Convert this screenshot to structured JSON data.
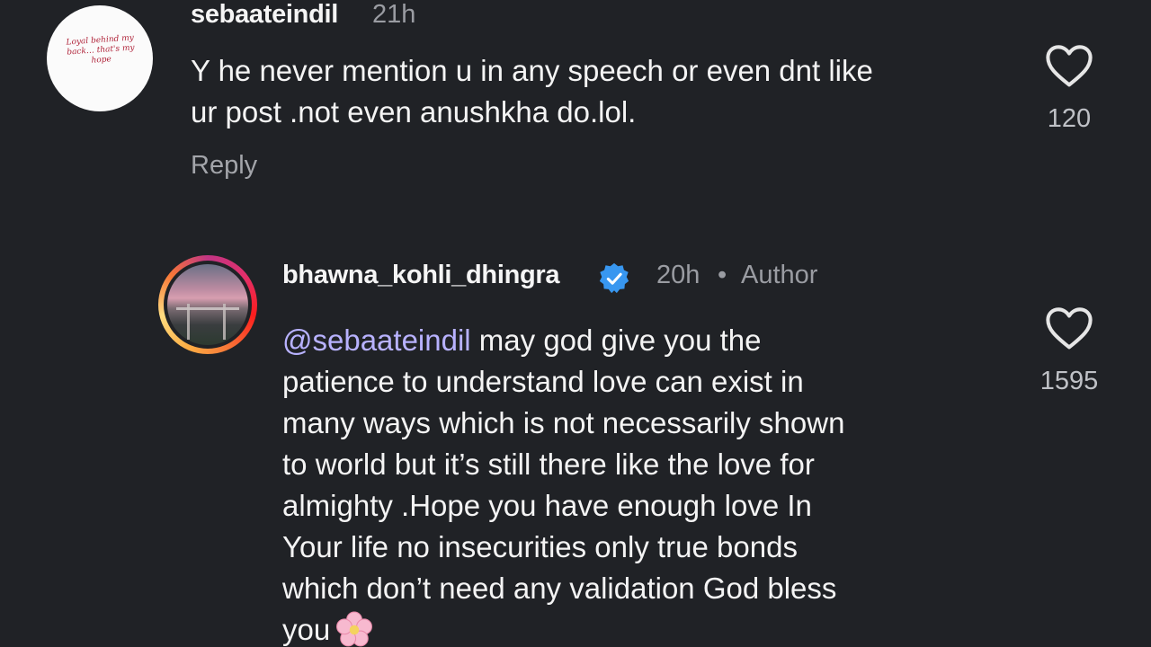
{
  "comments": [
    {
      "username": "sebaateindil",
      "time": "21h",
      "avatar_text": "Loyal behind my back… that's my hope",
      "text": "Y he never mention u in any speech or even dnt like\nur post .not even anushkha do.lol.",
      "reply_label": "Reply",
      "likes": "120"
    },
    {
      "username": "bhawna_kohli_dhingra",
      "verified": true,
      "time": "20h",
      "separator": "•",
      "author_label": "Author",
      "mention": "@sebaateindil",
      "text": " may god give you the\npatience to understand love can exist in\nmany ways which is not necessarily shown\nto world but it’s still there like the love for\nalmighty .Hope  you have enough love In\nYour life no insecurities only true bonds\nwhich don’t need any validation God bless\nyou",
      "emoji": "cherry-blossom",
      "likes": "1595"
    }
  ],
  "colors": {
    "background": "#202226",
    "mention": "#b8b2ff",
    "verified": "#3897f0",
    "muted": "#9a9ca2"
  }
}
